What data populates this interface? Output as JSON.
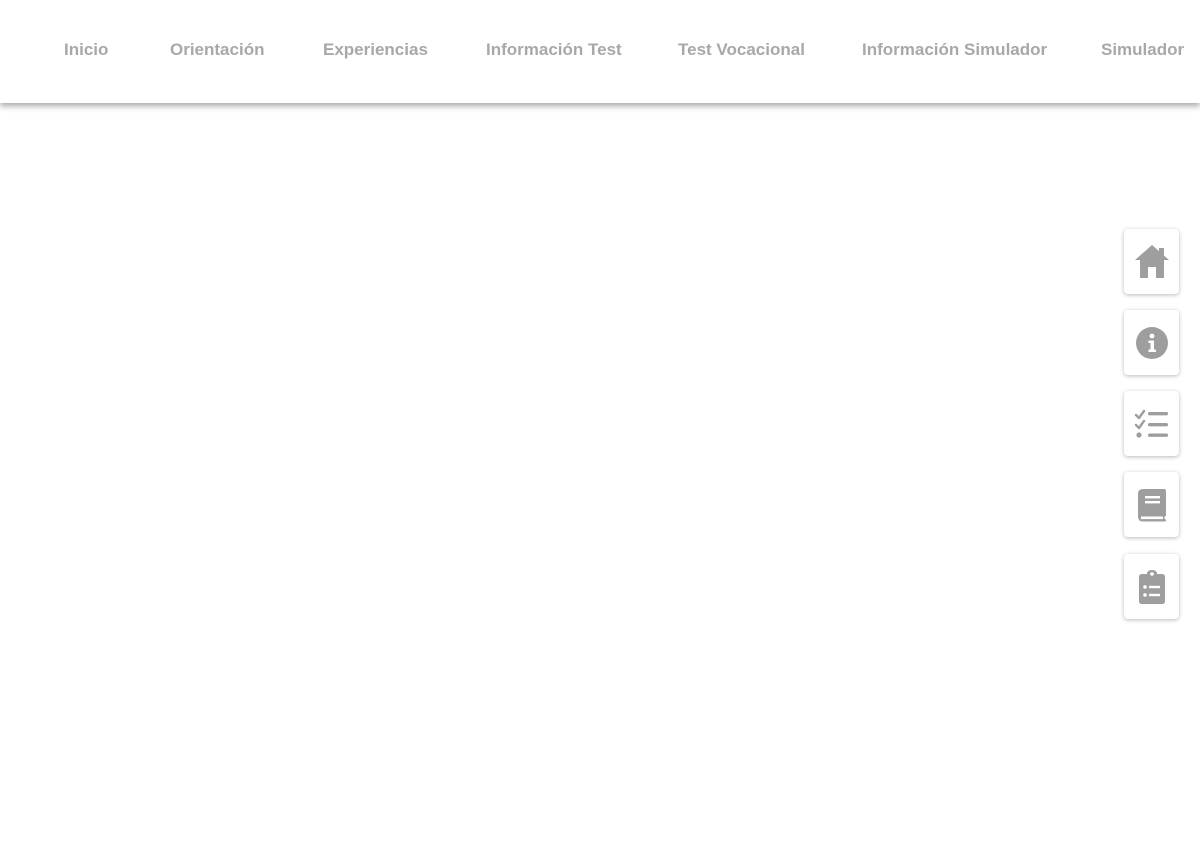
{
  "nav": {
    "items": [
      {
        "label": "Inicio"
      },
      {
        "label": "Orientación"
      },
      {
        "label": "Experiencias"
      },
      {
        "label": "Información Test"
      },
      {
        "label": "Test Vocacional"
      },
      {
        "label": "Información Simulador"
      },
      {
        "label": "Simulador"
      }
    ]
  },
  "side_buttons": [
    {
      "icon": "home-icon"
    },
    {
      "icon": "info-icon"
    },
    {
      "icon": "checklist-icon"
    },
    {
      "icon": "book-icon"
    },
    {
      "icon": "clipboard-list-icon"
    }
  ],
  "colors": {
    "nav_text": "#a8a8a8",
    "icon": "#9e9e9e",
    "background": "#ffffff"
  }
}
